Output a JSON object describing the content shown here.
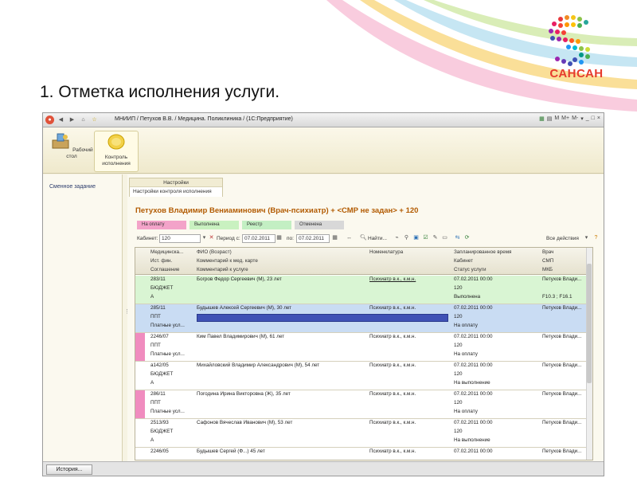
{
  "slide": {
    "title": "1. Отметка исполнения услуги.",
    "logo_text": "САНСАН"
  },
  "window": {
    "title": "МНИИП / Петухов В.В. / Медицина. Поликлиника / (1С:Предприятие)",
    "right_controls": [
      "M",
      "M+",
      "M-",
      "▾",
      "_",
      "□",
      "×"
    ]
  },
  "sections": [
    {
      "label": "Рабочий стол",
      "icon": "desktop-icon"
    },
    {
      "label": "Контроль исполнения",
      "icon": "control-icon"
    }
  ],
  "sidebar": {
    "items": [
      "Сменное задание"
    ]
  },
  "settings": {
    "header": "Настройки",
    "link": "Настройки контроля исполнения"
  },
  "heading": "Петухов Владимир Вениаминович (Врач-психиатр) + <СМР не задан> + 120",
  "legend": [
    "На оплату",
    "Выполнена",
    "Реестр",
    "Отменена"
  ],
  "filter": {
    "cabinet_label": "Кабинет:",
    "cabinet_value": "120",
    "period_label": "Период с:",
    "date_from": "07.02.2011",
    "to_label": "по:",
    "date_to": "07.02.2011",
    "find_label": "Найти...",
    "all_actions": "Все действия"
  },
  "columns": {
    "c1": [
      "Медицинска...",
      "Ист. фин.",
      "Соглашение"
    ],
    "c2": [
      "ФИО (Возраст)",
      "Комментарий к мед. карте",
      "Комментарий к услуге"
    ],
    "c3": [
      "Номенклатура"
    ],
    "c4": [
      "Запланированное время",
      "Кабинет",
      "Статус услуги"
    ],
    "c5": [
      "Врач",
      "СМП",
      "МКБ"
    ]
  },
  "rows": [
    {
      "card": "283/11",
      "fin": "БЮДЖЕТ",
      "agreement": "А",
      "name": "Богров Федор Сергеевич (М), 23 лет",
      "nomen": "Психиатр в.к., к.м.н.",
      "time": "07.02.2011 00:00",
      "cabinet": "120",
      "status": "Выполнена",
      "doctor": "Петухов Влади...",
      "mkb": "F10.3   ; F16.1",
      "bg": "#d9f5d3",
      "marker": ""
    },
    {
      "card": "285/11",
      "fin": "ППТ",
      "agreement": "Платные усл...",
      "name": "Будышев Алексей Сергеевич (М), 30 лет",
      "nomen": "Психиатр в.к., к.м.н.",
      "time": "07.02.2011 00:00",
      "cabinet": "120",
      "status": "На оплату",
      "doctor": "Петухов Влади...",
      "mkb": "",
      "bg": "#c9dcf3",
      "marker": ""
    },
    {
      "card": "2246/07",
      "fin": "ППТ",
      "agreement": "Платные усл...",
      "name": "Ким Павел Владимирович (М), 61 лет",
      "nomen": "Психиатр в.к., к.м.н.",
      "time": "07.02.2011 00:00",
      "cabinet": "120",
      "status": "На оплату",
      "doctor": "Петухов Влади...",
      "mkb": "",
      "bg": "#ffffff",
      "marker": "#f08cbf"
    },
    {
      "card": "а142/05",
      "fin": "БЮДЖЕТ",
      "agreement": "А",
      "name": "Михайловский Владимир Александрович (М), 54 лет",
      "nomen": "Психиатр в.к., к.м.н.",
      "time": "07.02.2011 00:00",
      "cabinet": "120",
      "status": "На выполнение",
      "doctor": "Петухов Влади...",
      "mkb": "",
      "bg": "#ffffff",
      "marker": ""
    },
    {
      "card": "286/11",
      "fin": "ППТ",
      "agreement": "Платные усл...",
      "name": "Погодина Ирина Викторовна (Ж), 35 лет",
      "nomen": "Психиатр в.к., к.м.н.",
      "time": "07.02.2011 00:00",
      "cabinet": "120",
      "status": "На оплату",
      "doctor": "Петухов Влади...",
      "mkb": "",
      "bg": "#ffffff",
      "marker": "#f08cbf"
    },
    {
      "card": "2513/93",
      "fin": "БЮДЖЕТ",
      "agreement": "А",
      "name": "Сафонов Вячеслав Иванович (М), 53 лет",
      "nomen": "Психиатр в.к., к.м.н.",
      "time": "07.02.2011 00:00",
      "cabinet": "120",
      "status": "На выполнение",
      "doctor": "Петухов Влади...",
      "mkb": "",
      "bg": "#ffffff",
      "marker": ""
    },
    {
      "card": "2246/05",
      "fin": "",
      "agreement": "",
      "name": "Будышев Сергей (Ф...) 45 лет",
      "nomen": "Психиатр в.к., к.м.н.",
      "time": "07.02.2011 00:00",
      "cabinet": "",
      "status": "",
      "doctor": "Петухов Влади...",
      "mkb": "",
      "bg": "#ffffff",
      "marker": ""
    }
  ],
  "bottom": {
    "history": "История..."
  }
}
